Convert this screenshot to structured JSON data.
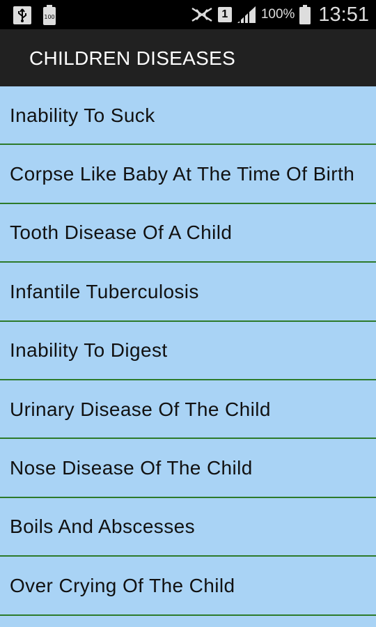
{
  "status_bar": {
    "icons_left": [
      "usb-icon",
      "battery-100-small-icon"
    ],
    "icons_right": [
      "nfc-icon",
      "sim-1-icon",
      "signal-icon",
      "battery-icon"
    ],
    "sim_label": "1",
    "battery_percent": "100%",
    "time": "13:51"
  },
  "app": {
    "title": "CHILDREN DISEASES"
  },
  "list": {
    "items": [
      {
        "label": "Inability To Suck"
      },
      {
        "label": "Corpse Like Baby At The Time Of Birth"
      },
      {
        "label": "Tooth Disease Of A Child"
      },
      {
        "label": "Infantile Tuberculosis"
      },
      {
        "label": "Inability To Digest"
      },
      {
        "label": "Urinary Disease Of The Child"
      },
      {
        "label": "Nose Disease Of The Child"
      },
      {
        "label": "Boils And Abscesses"
      },
      {
        "label": "Over Crying Of The Child"
      }
    ]
  },
  "colors": {
    "list_background": "#a9d3f5",
    "divider": "#2d7a2a",
    "action_bar": "#212121"
  }
}
